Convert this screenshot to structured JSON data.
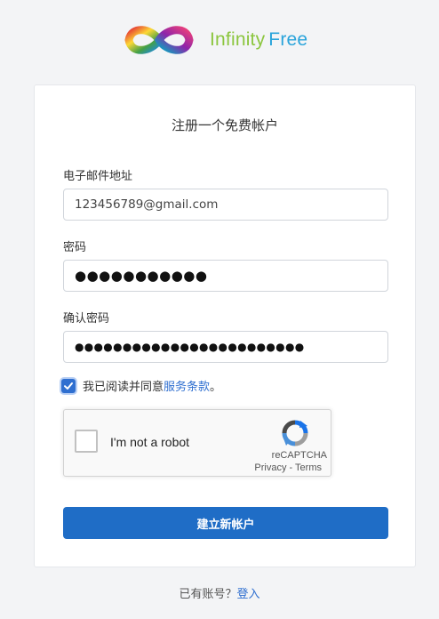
{
  "brand": {
    "name_part1": "Infinity",
    "name_part2": "Free"
  },
  "form": {
    "title": "注册一个免费帐户",
    "email": {
      "label": "电子邮件地址",
      "value": "123456789@gmail.com"
    },
    "password": {
      "label": "密码",
      "value": "●●●●●●●●●●●"
    },
    "confirm_password": {
      "label": "确认密码",
      "value": "●●●●●●●●●●●●●●●●●●●●●●●●"
    },
    "terms": {
      "checked": true,
      "prefix": "我已阅读并同意",
      "link_text": "服务条款",
      "suffix": "。"
    },
    "recaptcha": {
      "label": "I'm not a robot",
      "brand": "reCAPTCHA",
      "privacy": "Privacy",
      "separator": " - ",
      "terms": "Terms"
    },
    "submit_label": "建立新帐户"
  },
  "footer": {
    "prompt": "已有账号？",
    "login_link": "登入"
  },
  "colors": {
    "accent": "#1f6dc6",
    "link": "#2f6fd0",
    "brand_green": "#8cc63f",
    "brand_blue": "#2aa4db"
  }
}
